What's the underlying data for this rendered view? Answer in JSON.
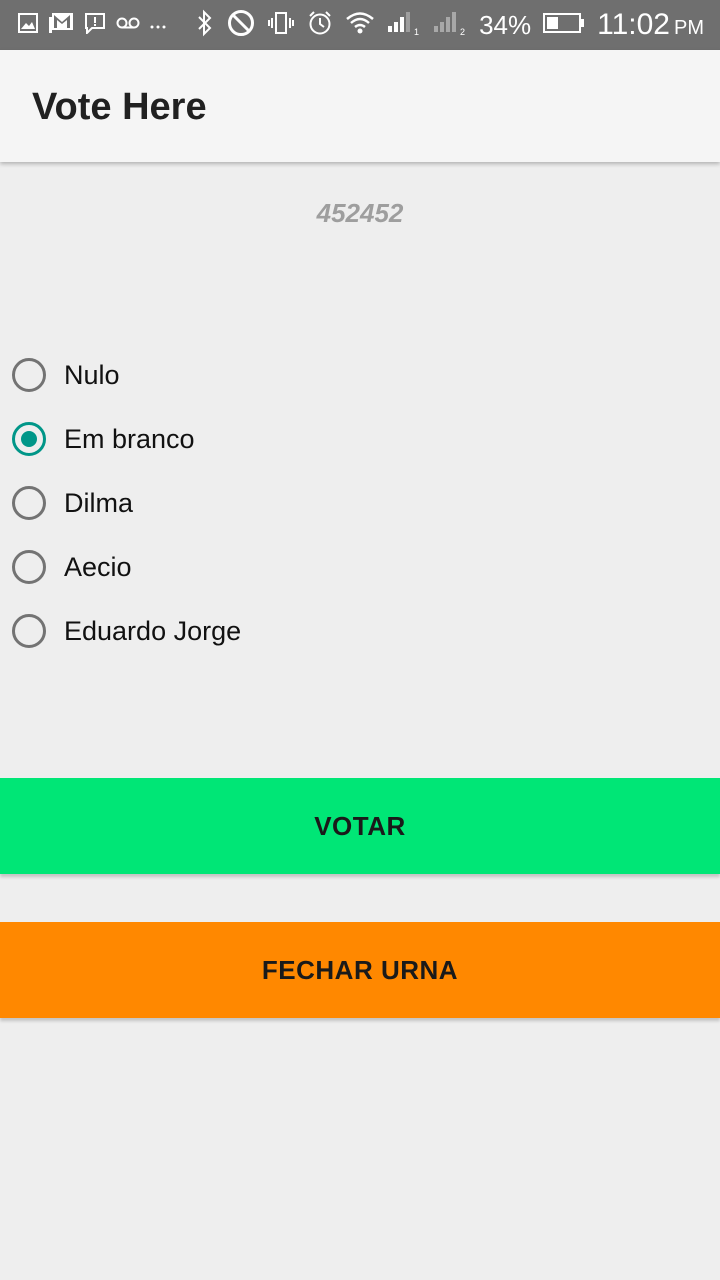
{
  "status_bar": {
    "left_icons": [
      "image-icon",
      "gmail-icon",
      "message-alert-icon",
      "voicemail-icon",
      "more-dots-icon"
    ],
    "right_icons": [
      "bluetooth-icon",
      "do-not-disturb-icon",
      "vibrate-icon",
      "alarm-icon",
      "wifi-icon",
      "signal-sim1-icon",
      "signal-sim2-icon",
      "battery-icon"
    ],
    "battery_percent": "34%",
    "time": "11:02",
    "ampm": "PM"
  },
  "appbar": {
    "title": "Vote Here"
  },
  "voter_id": "452452",
  "options": [
    {
      "label": "Nulo",
      "checked": false
    },
    {
      "label": "Em branco",
      "checked": true
    },
    {
      "label": "Dilma",
      "checked": false
    },
    {
      "label": "Aecio",
      "checked": false
    },
    {
      "label": "Eduardo Jorge",
      "checked": false
    }
  ],
  "buttons": {
    "votar": "VOTAR",
    "fechar_urna": "FECHAR URNA"
  },
  "colors": {
    "accent": "#009688",
    "votar_bg": "#00e676",
    "fechar_bg": "#ff8800"
  }
}
